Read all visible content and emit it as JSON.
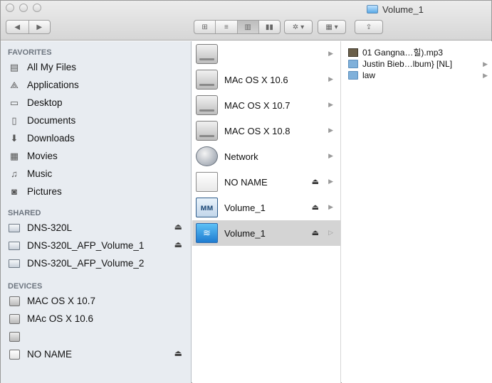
{
  "window": {
    "title": "Volume_1"
  },
  "toolbar": {
    "back": "◀",
    "forward": "▶",
    "view_icons": "⊞",
    "view_list": "≡",
    "view_columns": "▥",
    "view_coverflow": "▮▮",
    "action": "✲ ▾",
    "arrange": "▦ ▾",
    "share": "⇪"
  },
  "sidebar": {
    "favorites_header": "FAVORITES",
    "favorites": [
      {
        "label": "All My Files",
        "icon": "all-files-icon",
        "glyph": "▤"
      },
      {
        "label": "Applications",
        "icon": "applications-icon",
        "glyph": "⟁"
      },
      {
        "label": "Desktop",
        "icon": "desktop-icon",
        "glyph": "▭"
      },
      {
        "label": "Documents",
        "icon": "documents-icon",
        "glyph": "▯"
      },
      {
        "label": "Downloads",
        "icon": "downloads-icon",
        "glyph": "⬇"
      },
      {
        "label": "Movies",
        "icon": "movies-icon",
        "glyph": "▦"
      },
      {
        "label": "Music",
        "icon": "music-icon",
        "glyph": "♫"
      },
      {
        "label": "Pictures",
        "icon": "pictures-icon",
        "glyph": "◙"
      }
    ],
    "shared_header": "SHARED",
    "shared": [
      {
        "label": "DNS-320L",
        "eject": "⏏"
      },
      {
        "label": "DNS-320L_AFP_Volume_1",
        "eject": "⏏"
      },
      {
        "label": "DNS-320L_AFP_Volume_2",
        "eject": ""
      }
    ],
    "devices_header": "DEVICES",
    "devices": [
      {
        "label": "MAC OS X 10.7",
        "eject": ""
      },
      {
        "label": "MAc OS X 10.6",
        "eject": ""
      },
      {
        "label": "",
        "eject": ""
      },
      {
        "label": "NO NAME",
        "eject": "⏏"
      }
    ]
  },
  "column2": {
    "items": [
      {
        "label": "",
        "icon": "hard-drive-icon",
        "eject": "",
        "arrow": "▶",
        "selected": false
      },
      {
        "label": "MAc OS X 10.6",
        "icon": "hard-drive-icon",
        "eject": "",
        "arrow": "▶",
        "selected": false
      },
      {
        "label": "MAC OS X 10.7",
        "icon": "hard-drive-icon",
        "eject": "",
        "arrow": "▶",
        "selected": false
      },
      {
        "label": "MAC OS X 10.8",
        "icon": "hard-drive-icon",
        "eject": "",
        "arrow": "▶",
        "selected": false
      },
      {
        "label": "Network",
        "icon": "network-icon",
        "eject": "",
        "arrow": "▶",
        "selected": false
      },
      {
        "label": "NO NAME",
        "icon": "external-drive-icon",
        "eject": "⏏",
        "arrow": "▶",
        "selected": false
      },
      {
        "label": "Volume_1",
        "icon": "nas-volume-icon",
        "eject": "⏏",
        "arrow": "▶",
        "selected": false
      },
      {
        "label": "Volume_1",
        "icon": "wifi-volume-icon",
        "eject": "⏏",
        "arrow": "▷",
        "selected": true
      }
    ]
  },
  "column3": {
    "items": [
      {
        "label": "01 Gangna…힐).mp3",
        "icon": "mp3-file-icon",
        "arrow": ""
      },
      {
        "label": "Justin Bieb…lbum} [NL]",
        "icon": "folder-icon",
        "arrow": "▶"
      },
      {
        "label": "law",
        "icon": "folder-icon",
        "arrow": "▶"
      }
    ]
  }
}
